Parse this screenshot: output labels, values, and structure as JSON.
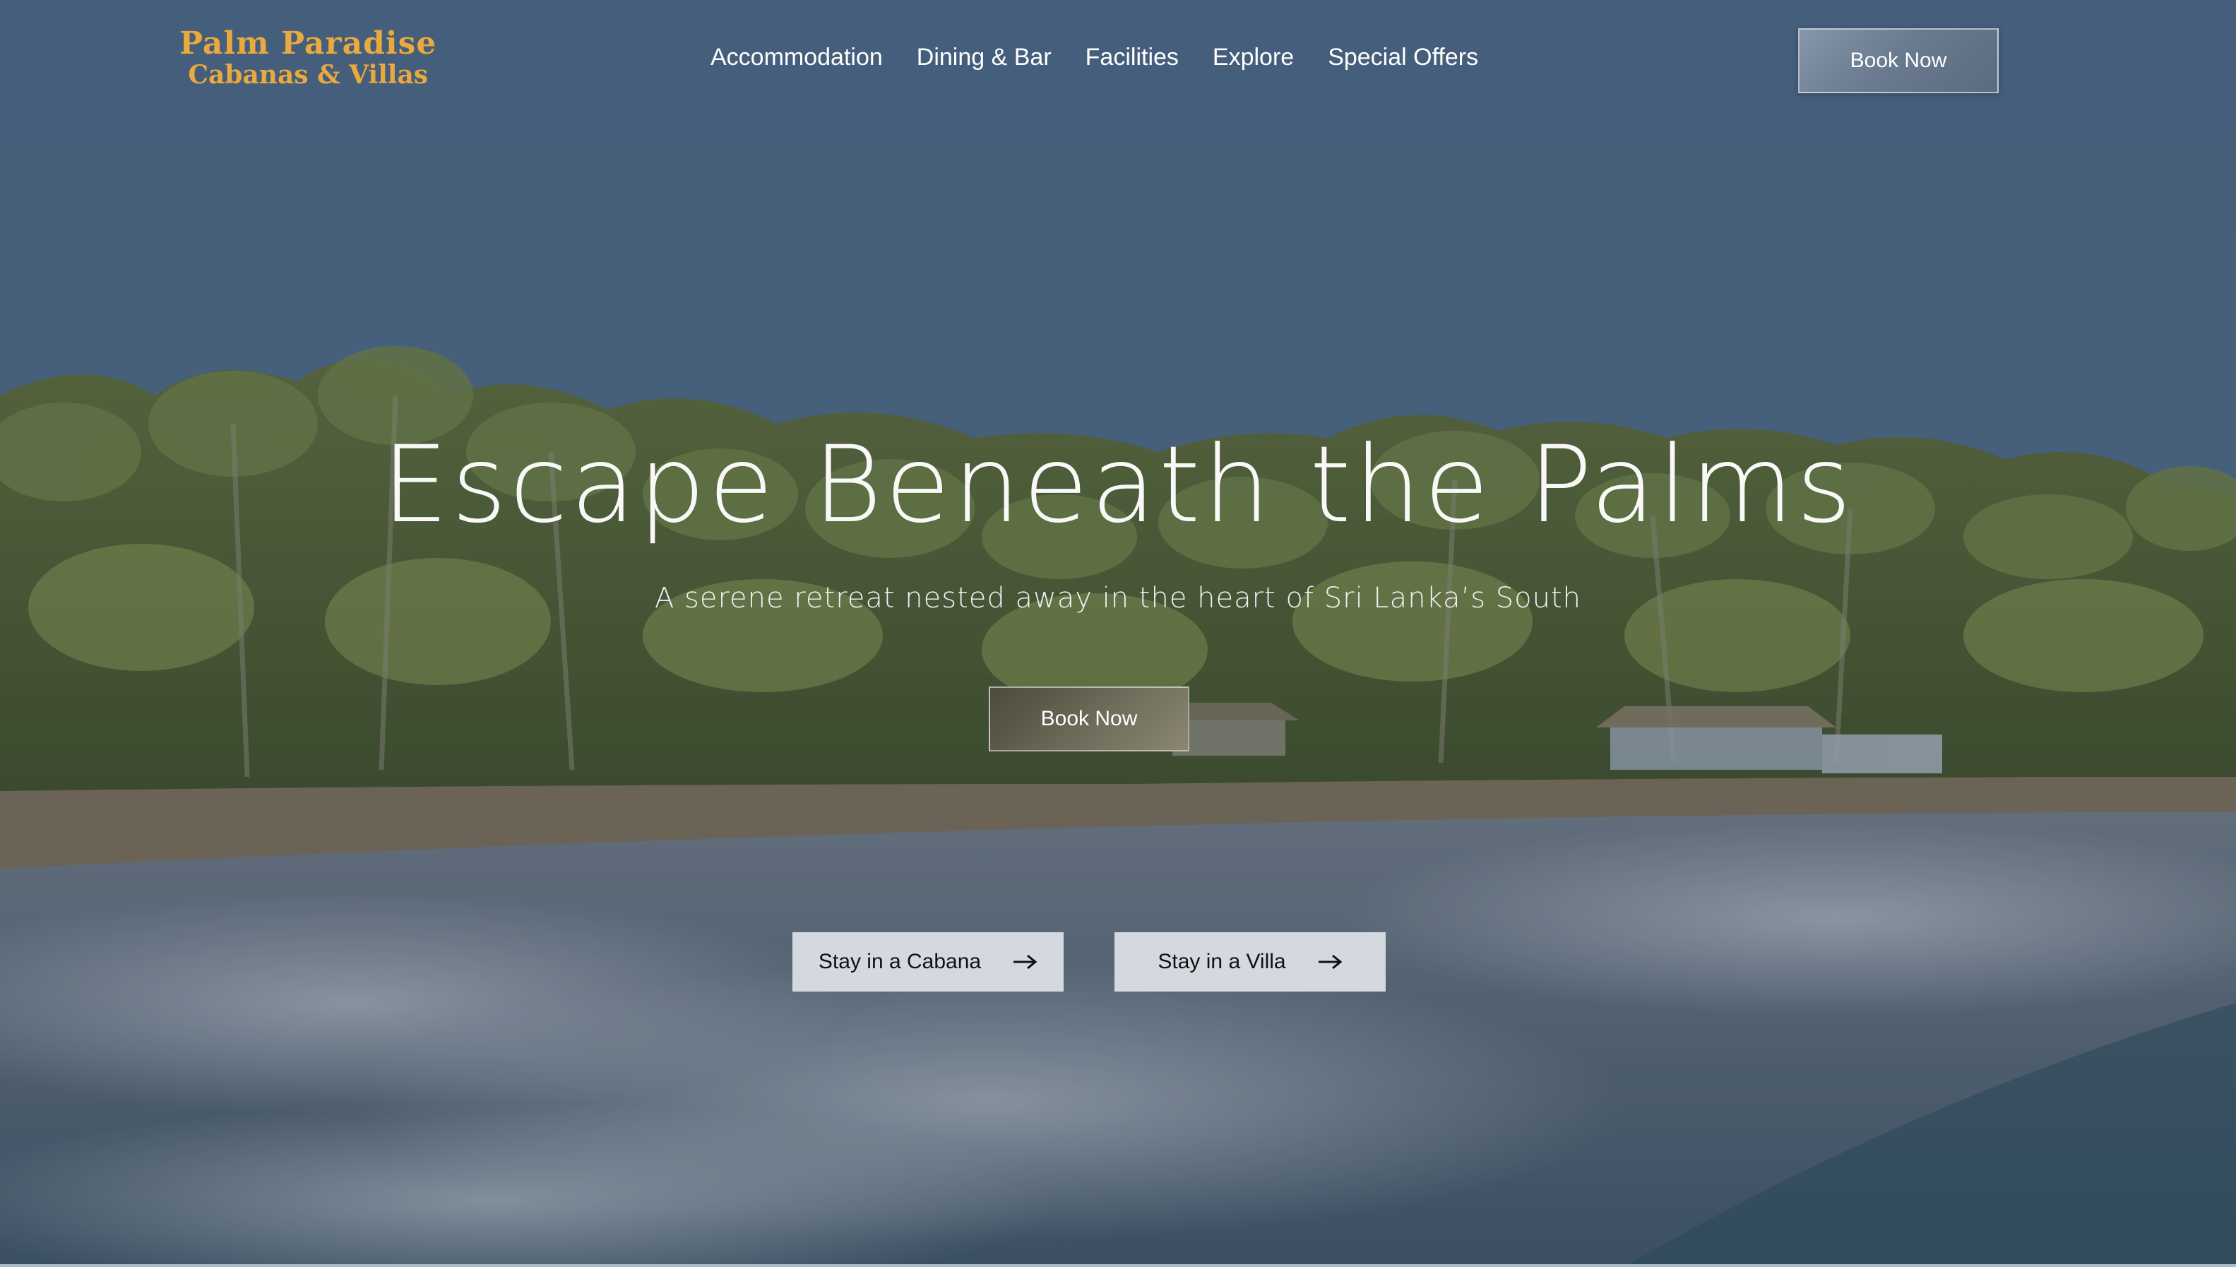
{
  "header": {
    "logo": {
      "line1": "Palm Paradise",
      "line2": "Cabanas & Villas"
    },
    "nav": [
      {
        "label": "Accommodation"
      },
      {
        "label": "Dining & Bar"
      },
      {
        "label": "Facilities"
      },
      {
        "label": "Explore"
      },
      {
        "label": "Special Offers"
      }
    ],
    "book_label": "Book Now"
  },
  "hero": {
    "title": "Escape Beneath the Palms",
    "subtitle": "A serene retreat nested away in the heart of Sri Lanka’s South",
    "book_label": "Book Now",
    "cta_cabana": "Stay in a Cabana",
    "cta_villa": "Stay in a Villa"
  },
  "colors": {
    "logo": "#e9a93e",
    "sky": "#4a6785",
    "cta_bg": "#d4d9e0"
  },
  "icons": {
    "cta_arrow": "arrow-right-icon"
  }
}
